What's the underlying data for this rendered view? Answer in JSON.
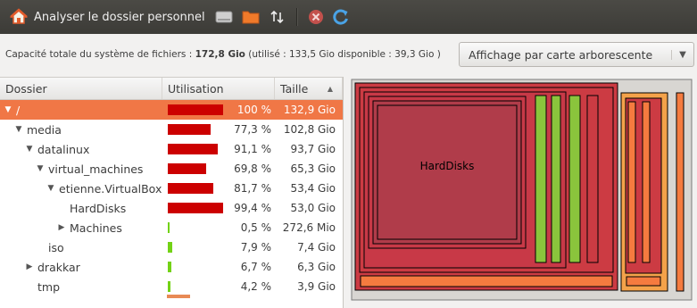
{
  "toolbar": {
    "title": "Analyser le dossier personnel",
    "icons": [
      "home-icon",
      "disk-icon",
      "folder-icon",
      "sort-arrows-icon",
      "stop-icon",
      "refresh-icon"
    ]
  },
  "info": {
    "capacity_label": "Capacité totale du système de fichiers : ",
    "capacity_value": "172,8 Gio",
    "capacity_detail": " (utilisé : 133,5 Gio disponible : 39,3 Gio )",
    "view_mode": "Affichage par carte arborescente"
  },
  "table": {
    "headers": [
      "Dossier",
      "Utilisation",
      "Taille"
    ],
    "rows": [
      {
        "name": "/",
        "pct": "100 %",
        "size": "132,9 Gio",
        "usage": 1.0,
        "color": "#cc0000",
        "level": 0,
        "expander": "open",
        "selected": true
      },
      {
        "name": "media",
        "pct": "77,3 %",
        "size": "102,8 Gio",
        "usage": 0.773,
        "color": "#cc0000",
        "level": 1,
        "expander": "open"
      },
      {
        "name": "datalinux",
        "pct": "91,1 %",
        "size": "93,7 Gio",
        "usage": 0.911,
        "color": "#cc0000",
        "level": 2,
        "expander": "open"
      },
      {
        "name": "virtual_machines",
        "pct": "69,8 %",
        "size": "65,3 Gio",
        "usage": 0.698,
        "color": "#cc0000",
        "level": 3,
        "expander": "open"
      },
      {
        "name": "etienne.VirtualBox",
        "pct": "81,7 %",
        "size": "53,4 Gio",
        "usage": 0.817,
        "color": "#cc0000",
        "level": 4,
        "expander": "open"
      },
      {
        "name": "HardDisks",
        "pct": "99,4 %",
        "size": "53,0 Gio",
        "usage": 0.994,
        "color": "#cc0000",
        "level": 5,
        "expander": "none"
      },
      {
        "name": "Machines",
        "pct": "0,5 %",
        "size": "272,6 Mio",
        "usage": 0.005,
        "color": "#73d216",
        "level": 5,
        "expander": "closed"
      },
      {
        "name": "iso",
        "pct": "7,9 %",
        "size": "7,4 Gio",
        "usage": 0.079,
        "color": "#73d216",
        "level": 3,
        "expander": "none"
      },
      {
        "name": "drakkar",
        "pct": "6,7 %",
        "size": "6,3 Gio",
        "usage": 0.067,
        "color": "#73d216",
        "level": 2,
        "expander": "closed"
      },
      {
        "name": "tmp",
        "pct": "4,2 %",
        "size": "3,9 Gio",
        "usage": 0.042,
        "color": "#73d216",
        "level": 2,
        "expander": "none"
      }
    ]
  },
  "treemap": {
    "label": "HardDisks",
    "colors": {
      "outer": "#cc3b43",
      "inner": "#c83947",
      "harddisks": "#b03c4a",
      "green": "#8ac43c",
      "orange": "#f57b3f",
      "light_orange": "#f4a24a"
    }
  }
}
